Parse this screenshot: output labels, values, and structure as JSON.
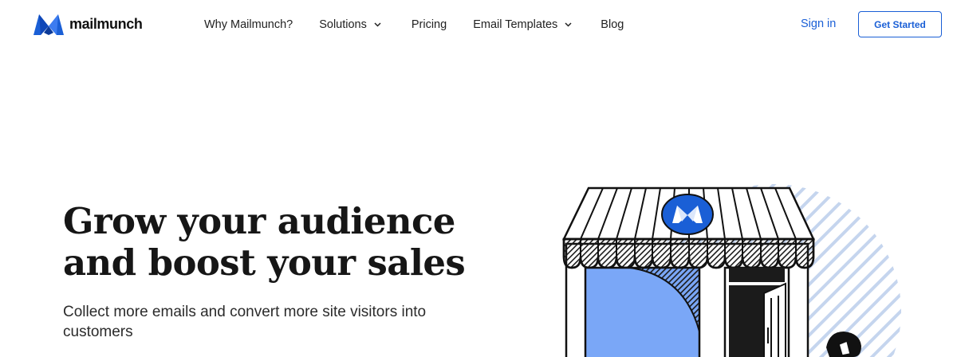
{
  "brand": {
    "name": "mailmunch",
    "color": "#1a5fd6",
    "logo_icon": "mailmunch-logo-icon"
  },
  "nav": {
    "items": [
      {
        "label": "Why Mailmunch?",
        "has_dropdown": false
      },
      {
        "label": "Solutions",
        "has_dropdown": true
      },
      {
        "label": "Pricing",
        "has_dropdown": false
      },
      {
        "label": "Email Templates",
        "has_dropdown": true
      },
      {
        "label": "Blog",
        "has_dropdown": false
      }
    ],
    "signin_label": "Sign in",
    "cta_label": "Get Started"
  },
  "hero": {
    "title_line1": "Grow your audience",
    "title_line2": "and boost your sales",
    "subtitle": "Collect more emails and convert more site visitors into customers",
    "illustration_icon": "storefront-illustration-icon",
    "colors": {
      "window": "#7aa7f7",
      "stripes": "#c5d5ee",
      "badge": "#1a5fd6"
    }
  }
}
